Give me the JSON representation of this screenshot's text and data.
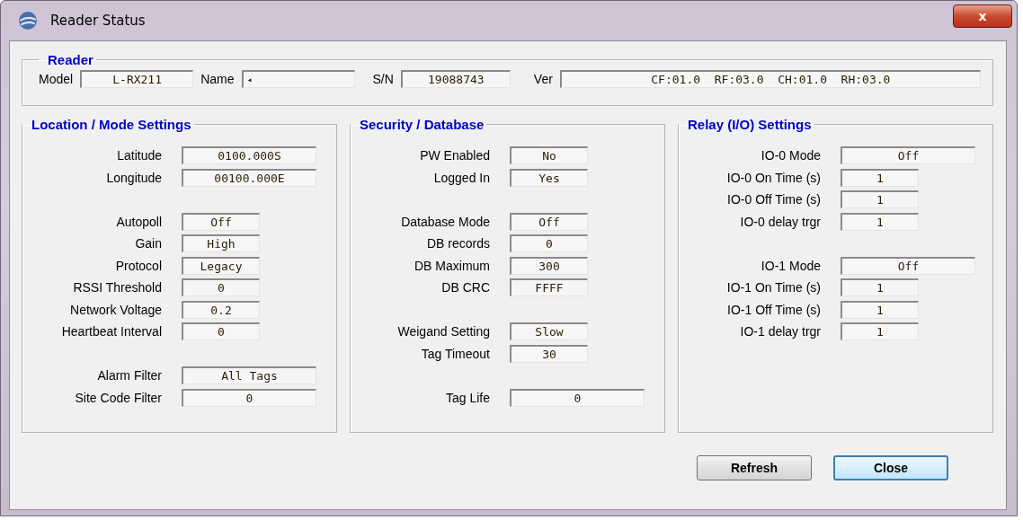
{
  "window": {
    "title": "Reader Status",
    "close_label": "x"
  },
  "reader": {
    "title": "Reader",
    "fields": [
      {
        "label": "Model",
        "value": "L-RX211",
        "kind": "model"
      },
      {
        "label": "Name",
        "value": "◂",
        "kind": "name"
      },
      {
        "label": "S/N",
        "value": "19088743",
        "kind": "serial"
      },
      {
        "label": "Ver",
        "value": "CF:01.0  RF:03.0  CH:01.0  RH:03.0",
        "kind": "version"
      }
    ]
  },
  "sections": [
    {
      "title": "Location / Mode Settings",
      "groups": [
        [
          {
            "label": "Latitude",
            "value": "0100.000S",
            "kind": "wide"
          },
          {
            "label": "Longitude",
            "value": "00100.000E",
            "kind": "wide"
          }
        ],
        [
          {
            "label": "Autopoll",
            "value": "Off",
            "kind": "narrow"
          },
          {
            "label": "Gain",
            "value": "High",
            "kind": "narrow"
          },
          {
            "label": "Protocol",
            "value": "Legacy",
            "kind": "narrow"
          },
          {
            "label": "RSSI Threshold",
            "value": "0",
            "kind": "narrow"
          },
          {
            "label": "Network Voltage",
            "value": "0.2",
            "kind": "narrow"
          },
          {
            "label": "Heartbeat Interval",
            "value": "0",
            "kind": "narrow"
          }
        ],
        [
          {
            "label": "Alarm Filter",
            "value": "All Tags",
            "kind": "wide"
          },
          {
            "label": "Site Code Filter",
            "value": "0",
            "kind": "wide"
          }
        ]
      ]
    },
    {
      "title": "Security / Database",
      "groups": [
        [
          {
            "label": "PW Enabled",
            "value": "No",
            "kind": "narrow"
          },
          {
            "label": "Logged In",
            "value": "Yes",
            "kind": "narrow"
          }
        ],
        [
          {
            "label": "Database Mode",
            "value": "Off",
            "kind": "narrow"
          },
          {
            "label": "DB records",
            "value": "0",
            "kind": "narrow"
          },
          {
            "label": "DB Maximum",
            "value": "300",
            "kind": "narrow"
          },
          {
            "label": "DB CRC",
            "value": "FFFF",
            "kind": "narrow"
          }
        ],
        [
          {
            "label": "Weigand Setting",
            "value": "Slow",
            "kind": "narrow"
          },
          {
            "label": "Tag Timeout",
            "value": "30",
            "kind": "narrow"
          }
        ],
        [
          {
            "label": "Tag Life",
            "value": "0",
            "kind": "wide"
          }
        ]
      ]
    },
    {
      "title": "Relay (I/O) Settings",
      "groups": [
        [
          {
            "label": "IO-0 Mode",
            "value": "Off",
            "kind": "wide"
          },
          {
            "label": "IO-0 On Time (s)",
            "value": "1",
            "kind": "narrow"
          },
          {
            "label": "IO-0 Off Time (s)",
            "value": "1",
            "kind": "narrow"
          },
          {
            "label": "IO-0 delay trgr",
            "value": "1",
            "kind": "narrow"
          }
        ],
        [
          {
            "label": "IO-1 Mode",
            "value": "Off",
            "kind": "wide"
          },
          {
            "label": "IO-1 On Time (s)",
            "value": "1",
            "kind": "narrow"
          },
          {
            "label": "IO-1 Off Time (s)",
            "value": "1",
            "kind": "narrow"
          },
          {
            "label": "IO-1 delay trgr",
            "value": "1",
            "kind": "narrow"
          }
        ]
      ]
    }
  ],
  "buttons": [
    {
      "label": "Refresh",
      "selected": false
    },
    {
      "label": "Close",
      "selected": true
    }
  ]
}
